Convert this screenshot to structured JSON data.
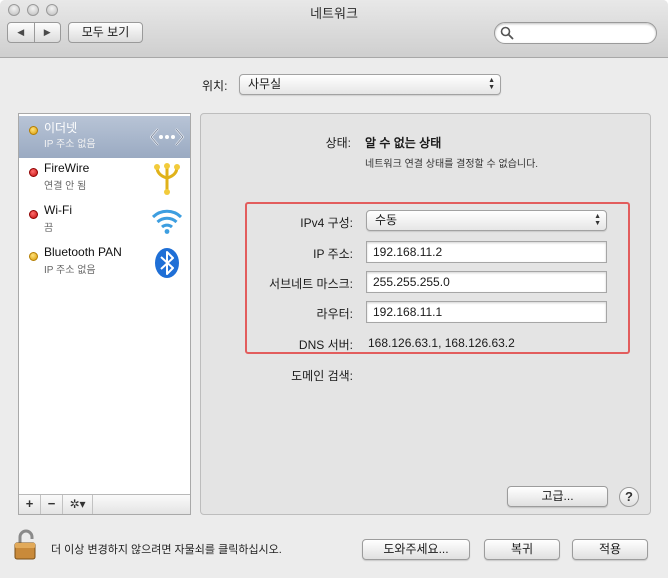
{
  "window": {
    "title": "네트워크"
  },
  "toolbar": {
    "back_label": "◀",
    "forward_label": "▶",
    "show_all_label": "모두 보기",
    "search_placeholder": ""
  },
  "location": {
    "label": "위치:",
    "value": "사무실"
  },
  "services": [
    {
      "name": "이더넷",
      "status": "IP 주소 없음",
      "indicator": "yellow",
      "icon": "ethernet-icon",
      "selected": true
    },
    {
      "name": "FireWire",
      "status": "연결 안 됨",
      "indicator": "red",
      "icon": "firewire-icon",
      "selected": false
    },
    {
      "name": "Wi-Fi",
      "status": "끔",
      "indicator": "red",
      "icon": "wifi-icon",
      "selected": false
    },
    {
      "name": "Bluetooth PAN",
      "status": "IP 주소 없음",
      "indicator": "yellow",
      "icon": "bluetooth-icon",
      "selected": false
    }
  ],
  "sidebar_controls": {
    "add": "+",
    "remove": "−",
    "action": "✲▾"
  },
  "detail": {
    "status_label": "상태:",
    "status_value": "알 수 없는 상태",
    "status_description": "네트워크 연결 상태를 결정할 수 없습니다.",
    "ipv4_label": "IPv4 구성:",
    "ipv4_value": "수동",
    "ip_label": "IP 주소:",
    "ip_value": "192.168.11.2",
    "subnet_label": "서브네트 마스크:",
    "subnet_value": "255.255.255.0",
    "router_label": "라우터:",
    "router_value": "192.168.11.1",
    "dns_label": "DNS 서버:",
    "dns_value": "168.126.63.1, 168.126.63.2",
    "domain_label": "도메인 검색:",
    "advanced_label": "고급...",
    "help_label": "?"
  },
  "footer": {
    "lock_text": "더 이상 변경하지 않으려면 자물쇠를 클릭하십시오.",
    "assist_label": "도와주세요...",
    "revert_label": "복귀",
    "apply_label": "적용"
  },
  "colors": {
    "highlight_box": "#e25d5d",
    "selected_row": "#a8b6cc"
  }
}
